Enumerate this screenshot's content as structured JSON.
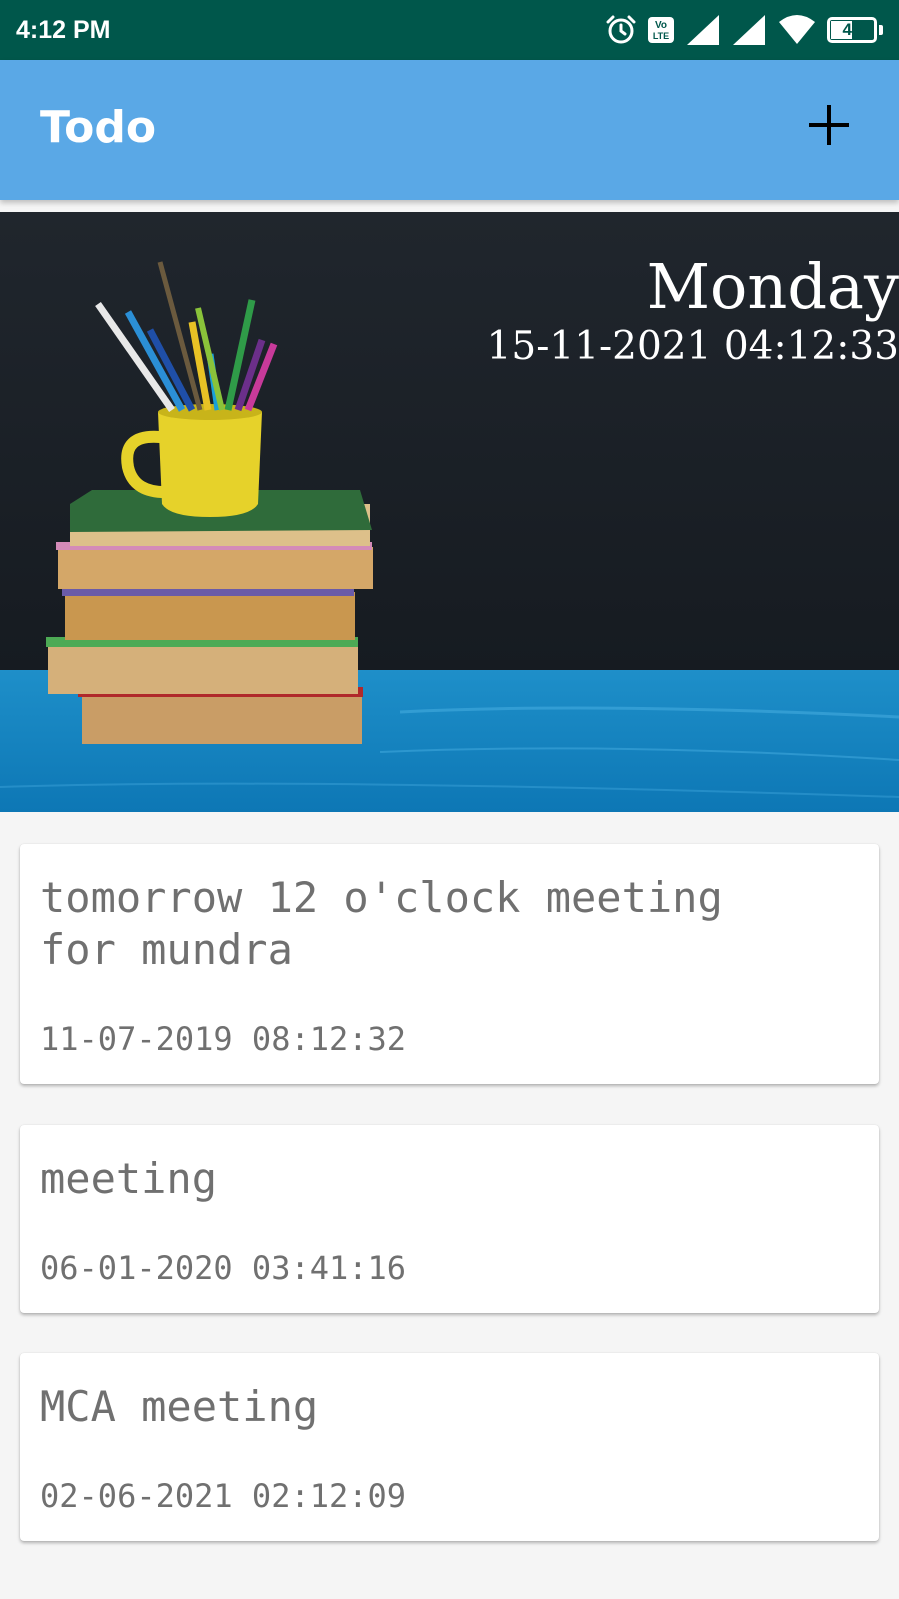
{
  "status_bar": {
    "time": "4:12 PM",
    "icons": [
      "alarm-icon",
      "volte-icon",
      "signal-icon",
      "signal-icon",
      "wifi-icon",
      "battery-icon"
    ],
    "volte_text": "Vo LTE",
    "battery_level": "49"
  },
  "app_bar": {
    "title": "Todo",
    "add_icon": "plus-icon",
    "color": "#5aa8e6"
  },
  "header": {
    "day": "Monday",
    "datetime": "15-11-2021 04:12:33"
  },
  "todos": [
    {
      "title": "tomorrow 12 o'clock meeting for mundra",
      "timestamp": "11-07-2019 08:12:32"
    },
    {
      "title": "meeting",
      "timestamp": "06-01-2020 03:41:16"
    },
    {
      "title": "MCA meeting",
      "timestamp": "02-06-2021 02:12:09"
    }
  ],
  "colors": {
    "status_bar": "#00574b",
    "app_bar": "#5aa8e6",
    "text_secondary": "#707070"
  }
}
